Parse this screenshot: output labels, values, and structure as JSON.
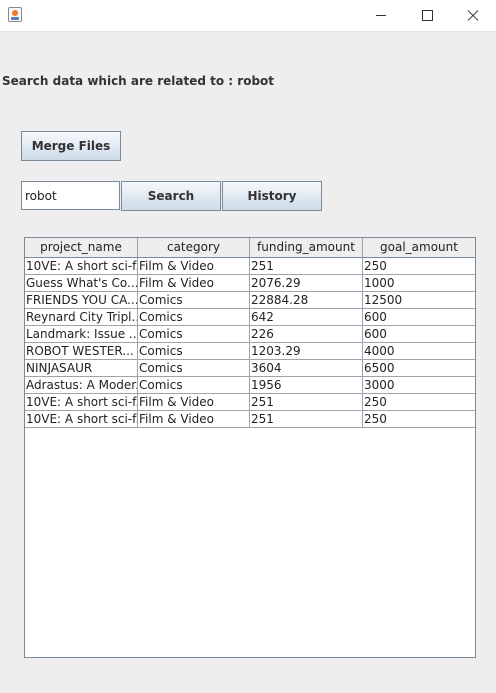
{
  "window": {
    "title": "",
    "icon": "java-icon"
  },
  "search_info": "Search data which are related to : robot",
  "buttons": {
    "merge": "Merge Files",
    "search": "Search",
    "history": "History"
  },
  "search": {
    "value": "robot"
  },
  "table": {
    "columns": [
      "project_name",
      "category",
      "funding_amount",
      "goal_amount"
    ],
    "rows": [
      [
        "10VE: A short sci-f...",
        "Film & Video",
        "251",
        "250"
      ],
      [
        "Guess What's Co...",
        "Film & Video",
        "2076.29",
        "1000"
      ],
      [
        "FRIENDS YOU CA...",
        "Comics",
        "22884.28",
        "12500"
      ],
      [
        "Reynard City Tripl...",
        "Comics",
        "642",
        "600"
      ],
      [
        "Landmark: Issue ...",
        "Comics",
        "226",
        "600"
      ],
      [
        "ROBOT WESTER...",
        "Comics",
        "1203.29",
        "4000"
      ],
      [
        "NINJASAUR",
        "Comics",
        "3604",
        "6500"
      ],
      [
        "Adrastus: A Moder...",
        "Comics",
        "1956",
        "3000"
      ],
      [
        "10VE: A short sci-f...",
        "Film & Video",
        "251",
        "250"
      ],
      [
        "10VE: A short sci-f...",
        "Film & Video",
        "251",
        "250"
      ]
    ]
  }
}
